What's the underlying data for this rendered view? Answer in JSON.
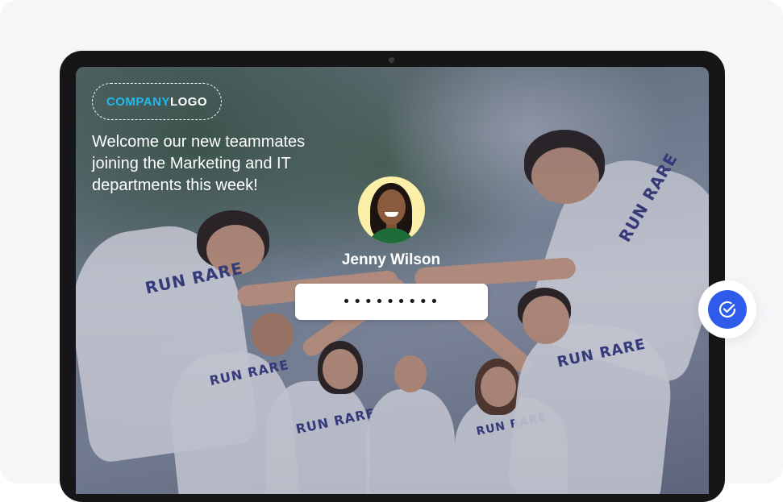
{
  "logo": {
    "part1": "COMPANY",
    "part2": "LOGO"
  },
  "welcome_message": "Welcome our new teammates joining the Marketing and IT departments this week!",
  "user": {
    "name": "Jenny Wilson"
  },
  "password": {
    "value": "•••••••••"
  },
  "shirt_print": "RUN RARE",
  "colors": {
    "accent": "#2f5bea",
    "logo_accent": "#22b8f0",
    "field_bg": "#ffffff"
  },
  "icons": {
    "confirm": "check-circle-icon"
  }
}
